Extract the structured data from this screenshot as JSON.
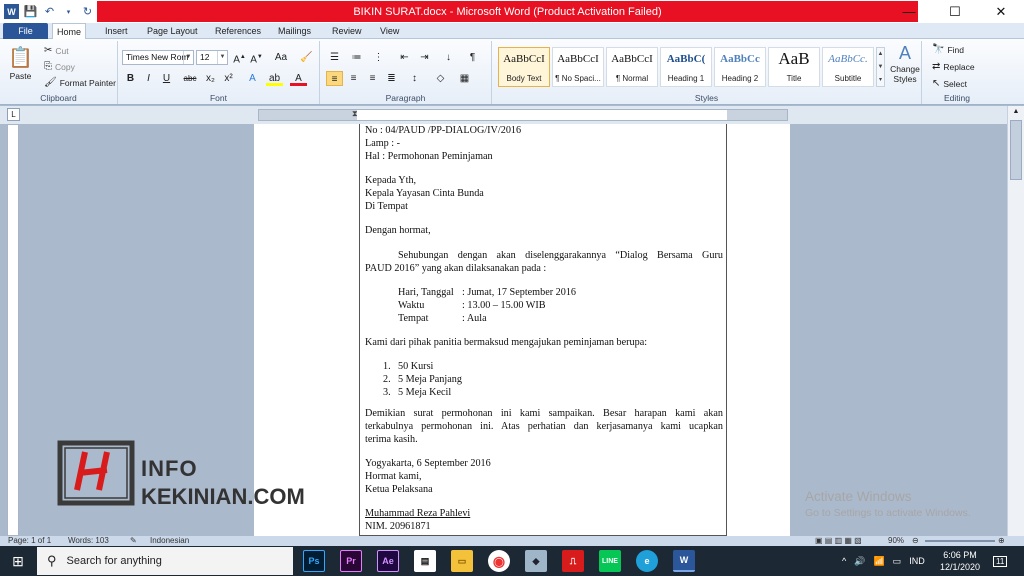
{
  "window": {
    "title": "BIKIN SURAT.docx  -  Microsoft Word (Product Activation Failed)",
    "minimize": "—",
    "maximize": "☐",
    "close": "✕"
  },
  "tabs": [
    "File",
    "Home",
    "Insert",
    "Page Layout",
    "References",
    "Mailings",
    "Review",
    "View"
  ],
  "ribbon": {
    "clipboard": {
      "paste": "Paste",
      "cut": "Cut",
      "copy": "Copy",
      "format_painter": "Format Painter",
      "label": "Clipboard"
    },
    "font": {
      "family": "Times New Rom",
      "size": "12",
      "label": "Font",
      "aa": "Aa",
      "bold": "B",
      "italic": "I",
      "underline": "U",
      "strike": "abc",
      "subscript": "x₂",
      "superscript": "x²"
    },
    "paragraph": {
      "label": "Paragraph"
    },
    "styles": {
      "items": [
        {
          "preview": "AaBbCcI",
          "name": "Body Text"
        },
        {
          "preview": "AaBbCcI",
          "name": "¶ No Spaci..."
        },
        {
          "preview": "AaBbCcI",
          "name": "¶ Normal"
        },
        {
          "preview": "AaBbC(",
          "name": "Heading 1"
        },
        {
          "preview": "AaBbCc",
          "name": "Heading 2"
        },
        {
          "preview": "AaB",
          "name": "Title"
        },
        {
          "preview": "AaBbCc.",
          "name": "Subtitle"
        }
      ],
      "change_styles": "Change Styles",
      "label": "Styles"
    },
    "editing": {
      "find": "Find",
      "replace": "Replace",
      "select": "Select",
      "label": "Editing"
    }
  },
  "document": {
    "no": "No      : 04/PAUD /PP-DIALOG/IV/2016",
    "lamp": "Lamp : -",
    "hal": "Hal      : Permohonan Peminjaman",
    "kepada1": "Kepada Yth,",
    "kepada2": "Kepala  Yayasan Cinta Bunda",
    "kepada3": "Di Tempat",
    "salam": "Dengan hormat,",
    "para1a": "Sehubungan  dengan  akan  diselenggarakannya  “Dialog  Bersama  Guru",
    "para1b": "PAUD 2016” yang  akan dilaksanakan pada :",
    "hari_label": "Hari, Tanggal",
    "hari_value": ": Jumat, 17 September 2016",
    "waktu_label": "Waktu",
    "waktu_value": ": 13.00 – 15.00 WIB",
    "tempat_label": "Tempat",
    "tempat_value": ": Aula",
    "para2": "Kami dari pihak panitia bermaksud mengajukan peminjaman berupa:",
    "list": [
      "50 Kursi",
      "5 Meja Panjang",
      "5 Meja Kecil"
    ],
    "para3a": "Demikian  surat  permohonan  ini  kami  sampaikan.  Besar  harapan  kami  akan",
    "para3b": "terkabulnya  permohonan  ini.  Atas  perhatian  dan  kerjasamanya  kami  ucapkan",
    "para3c": "terima kasih.",
    "tanggal": "Yogyakarta, 6 September 2016",
    "hormat": "Hormat kami,",
    "jabatan": "Ketua Pelaksana",
    "nama": "Muhammad  Reza  Pahlevi",
    "nim": "NIM. 20961871"
  },
  "status": {
    "page": "Page: 1 of 1",
    "words": "Words: 103",
    "language": "Indonesian",
    "zoom": "90%"
  },
  "watermark": {
    "activate_title": "Activate Windows",
    "activate_sub": "Go to Settings to activate Windows.",
    "logo_top": "INFO",
    "logo_bottom": "KEKINIAN.COM"
  },
  "taskbar": {
    "search_placeholder": "Search for anything",
    "apps": [
      "Ps",
      "Pr",
      "Ae"
    ],
    "lang": "IND",
    "time": "6:06 PM",
    "date": "12/1/2020",
    "notif_count": "11"
  }
}
